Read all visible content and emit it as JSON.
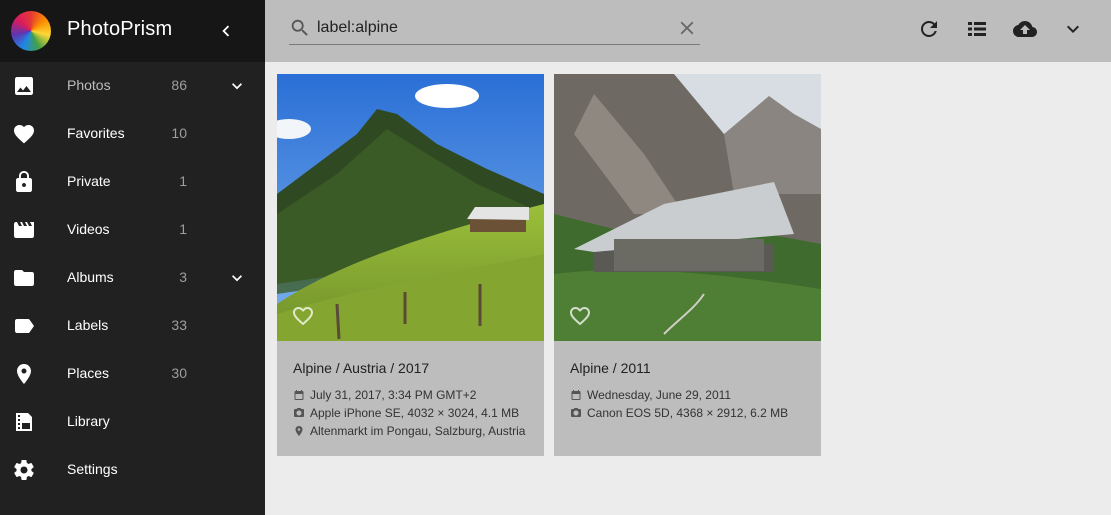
{
  "app": {
    "title": "PhotoPrism"
  },
  "sidebar": {
    "items": [
      {
        "label": "Photos",
        "count": "86",
        "icon": "image-icon",
        "has_chevron": true,
        "active": true
      },
      {
        "label": "Favorites",
        "count": "10",
        "icon": "heart-icon"
      },
      {
        "label": "Private",
        "count": "1",
        "icon": "lock-icon"
      },
      {
        "label": "Videos",
        "count": "1",
        "icon": "movie-icon"
      },
      {
        "label": "Albums",
        "count": "3",
        "icon": "folder-icon",
        "has_chevron": true
      },
      {
        "label": "Labels",
        "count": "33",
        "icon": "label-icon"
      },
      {
        "label": "Places",
        "count": "30",
        "icon": "place-icon"
      },
      {
        "label": "Library",
        "count": "",
        "icon": "library-icon"
      },
      {
        "label": "Settings",
        "count": "",
        "icon": "gear-icon"
      }
    ]
  },
  "search": {
    "value": "label:alpine",
    "placeholder": "Search"
  },
  "toolbar": {
    "icons": [
      "refresh-icon",
      "view-list-icon",
      "upload-icon",
      "chevron-down-icon"
    ]
  },
  "photos": [
    {
      "title": "Alpine / Austria / 2017",
      "date": "July 31, 2017, 3:34 PM GMT+2",
      "camera": "Apple iPhone SE, 4032 × 3024, 4.1 MB",
      "location": "Altenmarkt im Pongau, Salzburg, Austria"
    },
    {
      "title": "Alpine / 2011",
      "date": "Wednesday, June 29, 2011",
      "camera": "Canon EOS 5D, 4368 × 2912, 6.2 MB"
    }
  ],
  "colors": {
    "sidebar": "#212121",
    "brand_bar": "#161616",
    "toolbar": "#bdbdbd",
    "background": "#ececec",
    "card": "#bdbdbd"
  }
}
